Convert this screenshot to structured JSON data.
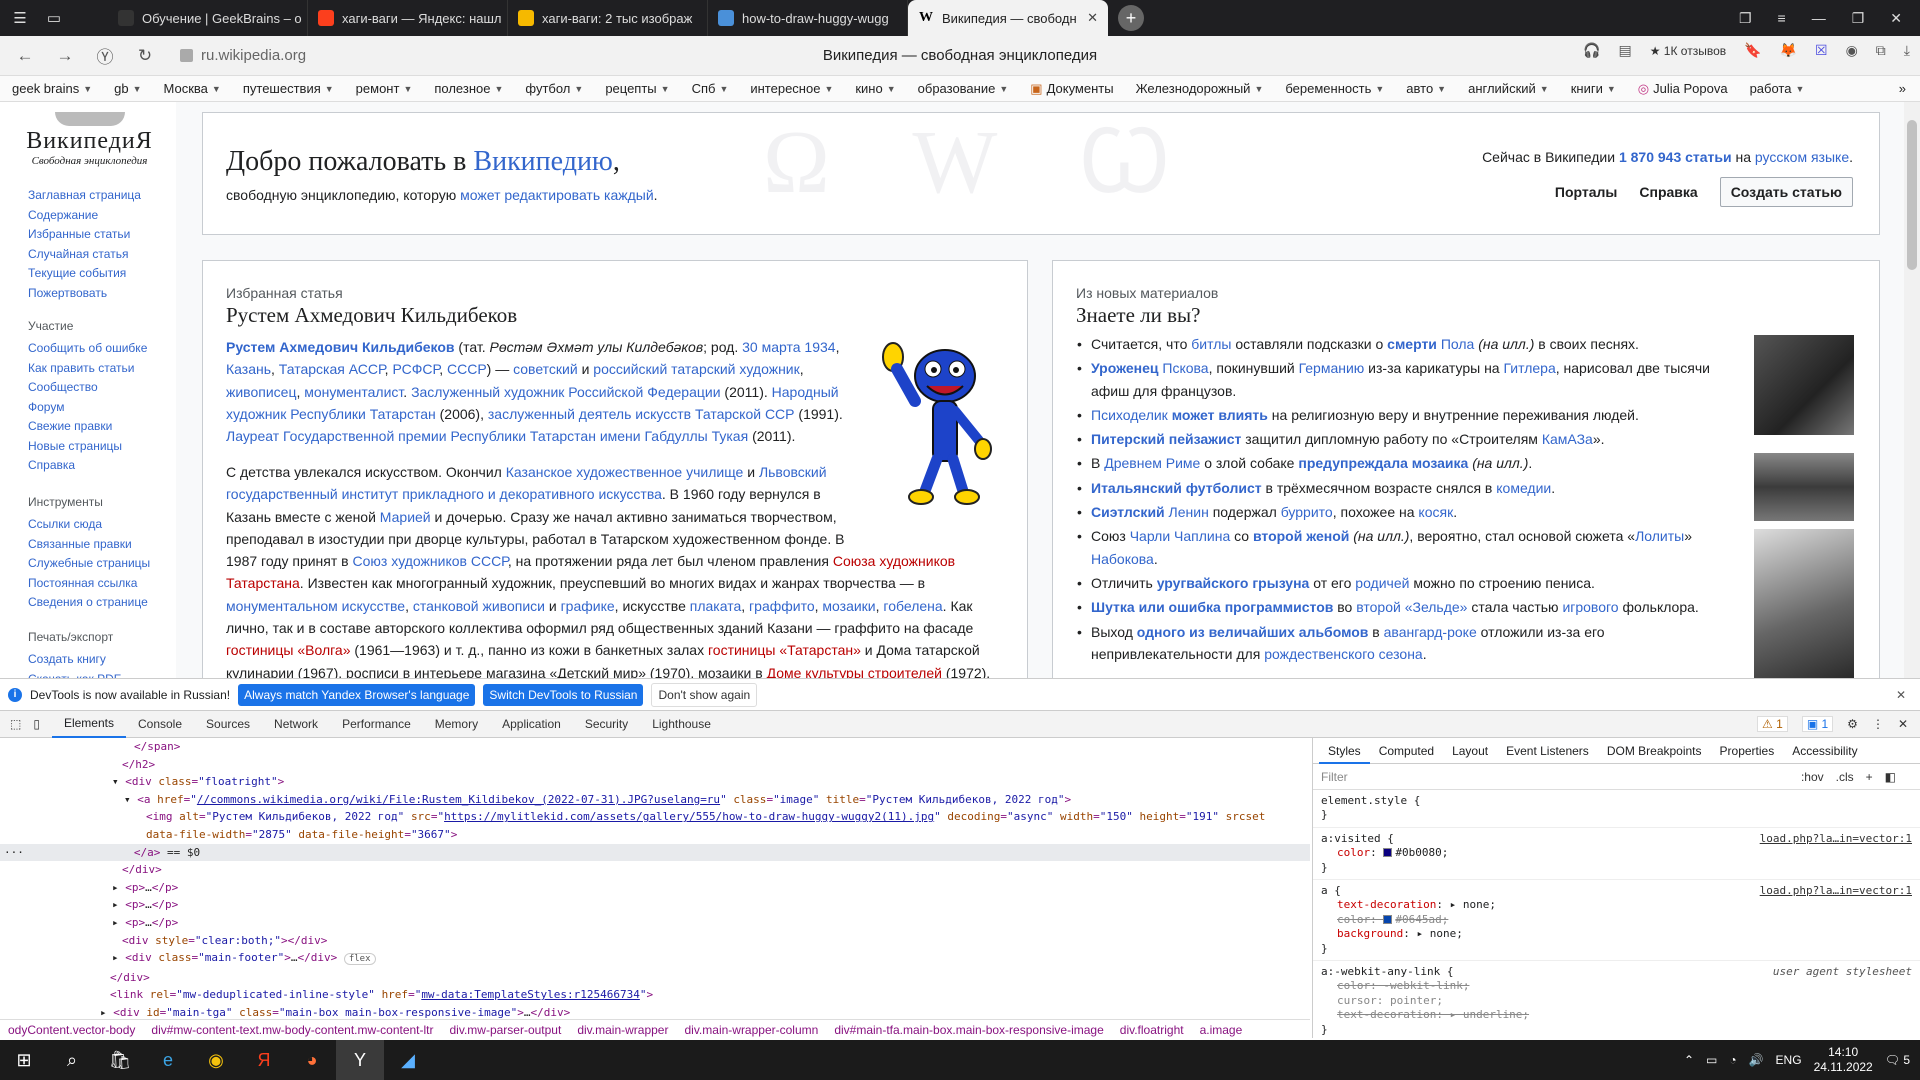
{
  "tabs": [
    {
      "title": "Обучение | GeekBrains – о",
      "icon": "geekbrains-icon",
      "color": "#333333"
    },
    {
      "title": "хаги-ваги — Яндекс: нашл",
      "icon": "yandex-icon",
      "color": "#fc3f1d"
    },
    {
      "title": "хаги-ваги: 2 тыс изображ",
      "icon": "yandex-images-icon",
      "color": "#f6b900"
    },
    {
      "title": "how-to-draw-huggy-wugg",
      "icon": "mylittlekid-icon",
      "color": "#4a90d9"
    },
    {
      "title": "Википедия — свободн",
      "icon": "wikipedia-icon",
      "color": "#ffffff",
      "active": true
    }
  ],
  "address": {
    "url": "ru.wikipedia.org",
    "page_title": "Википедия — свободная энциклопедия",
    "reviews": "★ 1К отзывов"
  },
  "bookmarks": [
    {
      "label": "geek brains",
      "dd": true
    },
    {
      "label": "gb",
      "dd": true
    },
    {
      "label": "Москва",
      "dd": true
    },
    {
      "label": "путешествия",
      "dd": true
    },
    {
      "label": "ремонт",
      "dd": true
    },
    {
      "label": "полезное",
      "dd": true
    },
    {
      "label": "футбол",
      "dd": true
    },
    {
      "label": "рецепты",
      "dd": true
    },
    {
      "label": "Спб",
      "dd": true
    },
    {
      "label": "интересное",
      "dd": true
    },
    {
      "label": "кино",
      "dd": true
    },
    {
      "label": "образование",
      "dd": true
    },
    {
      "label": "Документы",
      "dd": false
    },
    {
      "label": "Железнодорожный",
      "dd": true
    },
    {
      "label": "беременность",
      "dd": true
    },
    {
      "label": "авто",
      "dd": true
    },
    {
      "label": "английский",
      "dd": true
    },
    {
      "label": "книги",
      "dd": true
    },
    {
      "label": "Julia Popova",
      "dd": false
    },
    {
      "label": "работа",
      "dd": true
    }
  ],
  "wiki": {
    "logo": {
      "wordmark": "ВикипедиЯ",
      "tagline": "Свободная энциклопедия"
    },
    "nav_main": [
      "Заглавная страница",
      "Содержание",
      "Избранные статьи",
      "Случайная статья",
      "Текущие события",
      "Пожертвовать"
    ],
    "nav_participation": {
      "header": "Участие",
      "items": [
        "Сообщить об ошибке",
        "Как править статьи",
        "Сообщество",
        "Форум",
        "Свежие правки",
        "Новые страницы",
        "Справка"
      ]
    },
    "nav_tools": {
      "header": "Инструменты",
      "items": [
        "Ссылки сюда",
        "Связанные правки",
        "Служебные страницы",
        "Постоянная ссылка",
        "Сведения о странице"
      ]
    },
    "nav_print": {
      "header": "Печать/экспорт",
      "items": [
        "Создать книгу",
        "Скачать как PDF"
      ]
    },
    "welcome": {
      "title_prefix": "Добро пожаловать в ",
      "title_link": "Википедию",
      "title_suffix": ",",
      "sub_prefix": "свободную энциклопедию, которую ",
      "sub_link": "может редактировать каждый",
      "sub_suffix": ".",
      "stats_prefix": "Сейчас в Википедии ",
      "stats_count": "1 870 943 статьи",
      "stats_mid": " на ",
      "stats_lang": "русском языке",
      "stats_suffix": ".",
      "portals": "Порталы",
      "help": "Справка",
      "create": "Создать статью",
      "bg_glyphs": "Ω W Ꞷ"
    },
    "featured": {
      "caption": "Избранная статья",
      "title": "Рустем Ахмедович Кильдибеков"
    },
    "dyk": {
      "caption": "Из новых материалов",
      "title": "Знаете ли вы?"
    }
  },
  "devtools": {
    "infobar": {
      "message": "DevTools is now available in Russian!",
      "btn_match": "Always match Yandex Browser's language",
      "btn_switch": "Switch DevTools to Russian",
      "btn_dismiss": "Don't show again"
    },
    "tabs": [
      "Elements",
      "Console",
      "Sources",
      "Network",
      "Performance",
      "Memory",
      "Application",
      "Security",
      "Lighthouse"
    ],
    "warnings": "⚠ 1",
    "messages": "▣ 1",
    "styles_tabs": [
      "Styles",
      "Computed",
      "Layout",
      "Event Listeners",
      "DOM Breakpoints",
      "Properties",
      "Accessibility"
    ],
    "filter_placeholder": "Filter",
    "hov": ":hov",
    "cls": ".cls",
    "breadcrumbs": [
      "odyContent.vector-body",
      "div#mw-content-text.mw-body-content.mw-content-ltr",
      "div.mw-parser-output",
      "div.main-wrapper",
      "div.main-wrapper-column",
      "div#main-tfa.main-box.main-box-responsive-image",
      "div.floatright",
      "a.image"
    ]
  },
  "taskbar": {
    "lang": "ENG",
    "time": "14:10",
    "date": "24.11.2022",
    "notifications": "5"
  },
  "colors": {
    "link": "#3366cc",
    "redlink": "#ba0000",
    "accent": "#1a73e8"
  }
}
